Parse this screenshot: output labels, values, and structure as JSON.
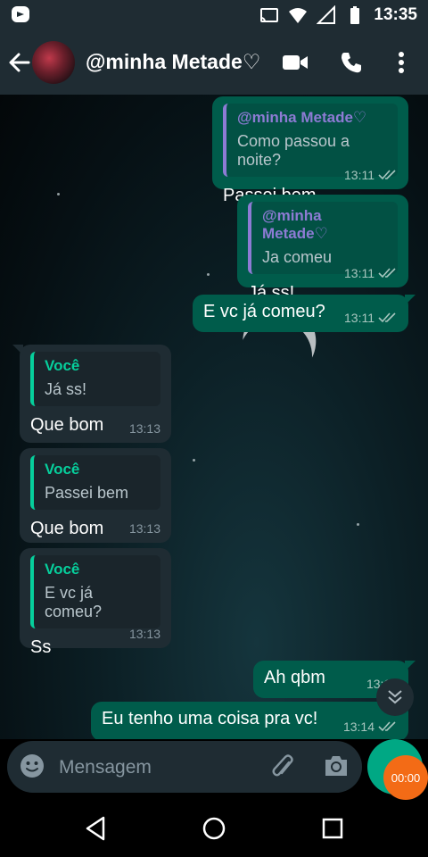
{
  "status_bar": {
    "time": "13:35",
    "icons": [
      "whatsapp-status-icon",
      "cast-icon",
      "wifi-icon",
      "signal-icon",
      "battery-icon"
    ]
  },
  "header": {
    "contact_name": "@minha Metade♡",
    "icons": [
      "back-arrow-icon",
      "video-call-icon",
      "phone-icon",
      "more-options-icon"
    ]
  },
  "messages": [
    {
      "direction": "out",
      "quote_author": "@minha Metade♡",
      "quote_text": "Como passou a noite?",
      "text": "Passei bem",
      "time": "13:11",
      "status": "read"
    },
    {
      "direction": "out",
      "quote_author": "@minha Metade♡",
      "quote_text": "Ja comeu",
      "text": "Já ss!",
      "time": "13:11",
      "status": "read"
    },
    {
      "direction": "out",
      "text": "E vc já comeu?",
      "time": "13:11",
      "status": "read"
    },
    {
      "direction": "in",
      "quote_author": "Você",
      "quote_text": "Já ss!",
      "text": "Que bom",
      "time": "13:13"
    },
    {
      "direction": "in",
      "quote_author": "Você",
      "quote_text": "Passei bem",
      "text": "Que bom",
      "time": "13:13"
    },
    {
      "direction": "in",
      "quote_author": "Você",
      "quote_text": "E vc já comeu?",
      "text": "Ss",
      "time": "13:13"
    },
    {
      "direction": "out",
      "text": "Ah qbm",
      "time": "13:13",
      "status": "read"
    },
    {
      "direction": "out",
      "text": "Eu tenho uma coisa pra vc!",
      "time": "13:14",
      "status": "read"
    }
  ],
  "input": {
    "placeholder": "Mensagem",
    "recording_time": "00:00"
  },
  "colors": {
    "header_bg": "#1f2c33",
    "outgoing_bubble": "#005c4b",
    "incoming_bubble": "#1f2c33",
    "accent_green": "#00a884",
    "quote_purple": "#8d7bd4",
    "quote_green": "#06cf9c",
    "recording_orange": "#f36b16"
  }
}
